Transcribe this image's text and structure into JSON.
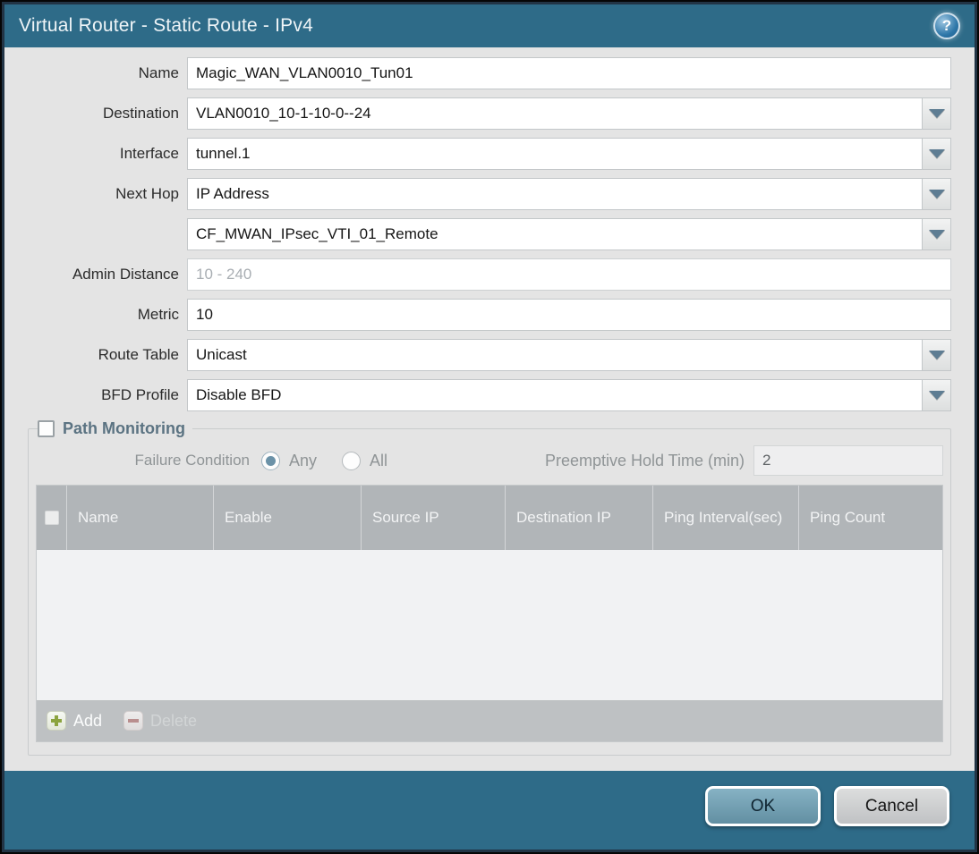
{
  "window": {
    "title": "Virtual Router - Static Route - IPv4",
    "help_glyph": "?",
    "colors": {
      "titlebar": "#2e6b88",
      "body_bg": "#e4e4e4",
      "table_header_bg": "#b1b5b8",
      "ok_button": "#6fa4ba",
      "border": "#223445"
    }
  },
  "form": {
    "fields": [
      {
        "label": "Name",
        "type": "text",
        "value": "Magic_WAN_VLAN0010_Tun01"
      },
      {
        "label": "Destination",
        "type": "dropdown",
        "value": "VLAN0010_10-1-10-0--24"
      },
      {
        "label": "Interface",
        "type": "dropdown",
        "value": "tunnel.1"
      },
      {
        "label": "Next Hop",
        "type": "dropdown",
        "value": "IP Address"
      },
      {
        "label": "",
        "type": "dropdown",
        "value": "CF_MWAN_IPsec_VTI_01_Remote"
      },
      {
        "label": "Admin Distance",
        "type": "text",
        "value": "",
        "placeholder": "10 - 240"
      },
      {
        "label": "Metric",
        "type": "text",
        "value": "10"
      },
      {
        "label": "Route Table",
        "type": "dropdown",
        "value": "Unicast"
      },
      {
        "label": "BFD Profile",
        "type": "dropdown",
        "value": "Disable BFD"
      }
    ]
  },
  "path_monitoring": {
    "legend": "Path Monitoring",
    "enabled": false,
    "failure_condition_label": "Failure Condition",
    "failure_options": [
      {
        "label": "Any",
        "selected": true
      },
      {
        "label": "All",
        "selected": false
      }
    ],
    "preemptive_label": "Preemptive Hold Time (min)",
    "preemptive_value": "2",
    "table": {
      "columns": [
        "Name",
        "Enable",
        "Source IP",
        "Destination IP",
        "Ping Interval(sec)",
        "Ping Count"
      ],
      "rows": []
    },
    "toolbar": {
      "add_label": "Add",
      "delete_label": "Delete",
      "delete_enabled": false
    }
  },
  "footer": {
    "ok_label": "OK",
    "cancel_label": "Cancel"
  }
}
